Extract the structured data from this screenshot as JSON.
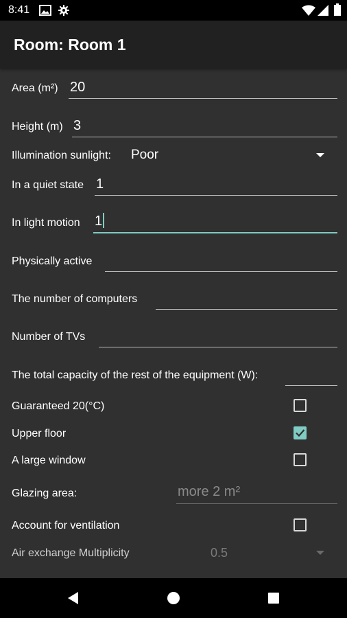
{
  "status_bar": {
    "time": "8:41",
    "left_icons": [
      "image-icon",
      "gear-icon"
    ],
    "right_icons": [
      "wifi-icon",
      "signal-icon",
      "battery-icon"
    ]
  },
  "app_bar": {
    "title": "Room: Room 1"
  },
  "form": {
    "area": {
      "label": "Area (m²)",
      "value": "20"
    },
    "height": {
      "label": "Height (m)",
      "value": "3"
    },
    "illumination": {
      "label": "Illumination sunlight:",
      "value": "Poor"
    },
    "quiet": {
      "label": "In a quiet state",
      "value": "1"
    },
    "light_motion": {
      "label": "In light motion",
      "value": "1"
    },
    "physically_active": {
      "label": "Physically active",
      "value": ""
    },
    "computers": {
      "label": "The number of computers",
      "value": ""
    },
    "tvs": {
      "label": "Number of TVs",
      "value": ""
    },
    "equipment": {
      "label": "The total capacity of the rest of the equipment (W):",
      "value": ""
    },
    "guaranteed": {
      "label": "Guaranteed 20(°C)",
      "checked": false
    },
    "upper_floor": {
      "label": "Upper floor",
      "checked": true
    },
    "large_window": {
      "label": "A large window",
      "checked": false
    },
    "glazing": {
      "label": "Glazing area:",
      "placeholder": "more 2 m²"
    },
    "ventilation": {
      "label": "Account for ventilation",
      "checked": false
    },
    "air_exchange": {
      "label": "Air exchange Multiplicity",
      "value": "0.5"
    }
  },
  "nav_bar": {
    "buttons": [
      "back-icon",
      "home-icon",
      "recents-icon"
    ]
  },
  "colors": {
    "accent": "#80cbc4",
    "background": "#303030",
    "app_bar": "#212121"
  }
}
